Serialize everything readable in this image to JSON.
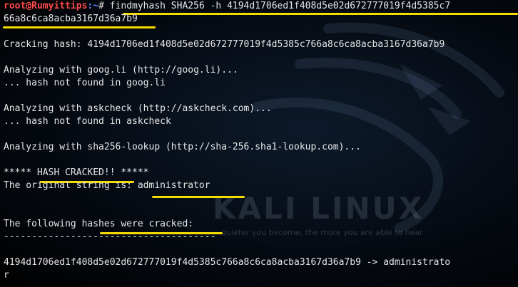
{
  "prompt": {
    "user_host": "root@Rumyittips",
    "dir": ":~",
    "symbol": "# "
  },
  "command": "findmyhash SHA256 -h 4194d1706ed1f408d5e02d672777019f4d5385c7",
  "command_wrap": "66a8c6ca8acba3167d36a7b9",
  "cracking": "Cracking hash: 4194d1706ed1f408d5e02d672777019f4d5385c766a8c6ca8acba3167d36a7b9",
  "analyzing1": "Analyzing with goog.li (http://goog.li)...",
  "notfound1": "... hash not found in goog.li",
  "analyzing2": "Analyzing with askcheck (http://askcheck.com)...",
  "notfound2": "... hash not found in askcheck",
  "analyzing3": "Analyzing with sha256-lookup (http://sha-256.sha1-lookup.com)...",
  "cracked_banner": "***** HASH CRACKED!! *****",
  "original_label": "The original string is: ",
  "original_value": "administrator",
  "following": "The following hashes were cracked:",
  "dashes": "--------------------------------------",
  "result_line": "4194d1706ed1f408d5e02d672777019f4d5385c766a8c6ca8acba3167d36a7b9 -> administrato",
  "result_wrap": "r",
  "wallpaper": {
    "brand": "KALI LINUX",
    "tagline": "quieter you become, the more you are able to hear"
  },
  "colors": {
    "background": "#000000",
    "text": "#e6e6e6",
    "prompt_user": "#ff4a4a",
    "prompt_dir": "#5b8cff",
    "highlight_underline": "#f5dc00"
  },
  "icons": [
    "kali-dragon-icon"
  ]
}
